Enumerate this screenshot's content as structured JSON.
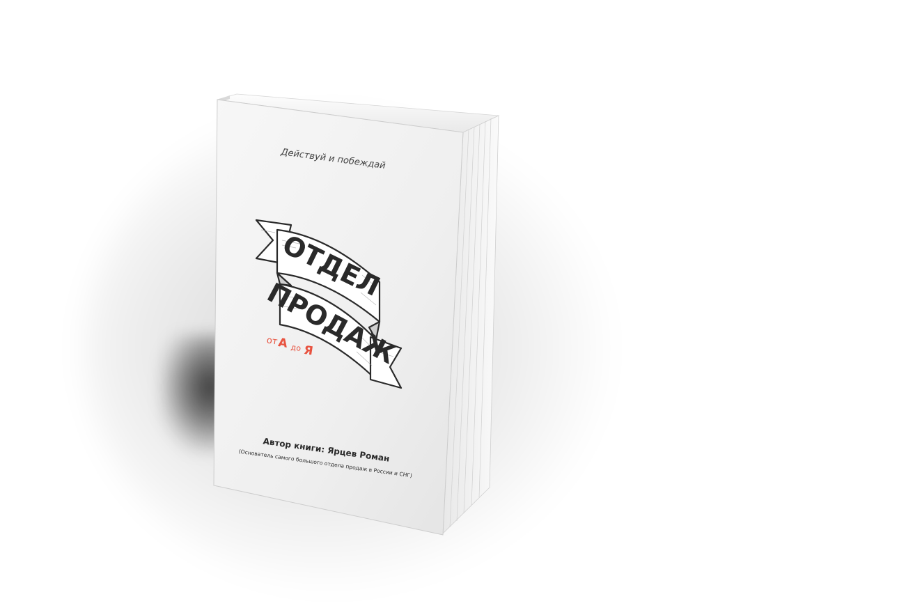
{
  "cover": {
    "tagline": "Действуй и побеждай",
    "title_line1": "ОТДЕЛ",
    "title_line2": "ПРОДАЖ",
    "subtitle_ot": "от",
    "subtitle_a": "А",
    "subtitle_do": "до",
    "subtitle_ya": "Я",
    "author": "Автор книги: Ярцев Роман",
    "author_note": "(Основатель самого большого отдела продаж в России и СНГ)"
  },
  "colors": {
    "accent_red": "#e8523f",
    "ink": "#2a2a2a",
    "cover": "#f2f2f2"
  }
}
